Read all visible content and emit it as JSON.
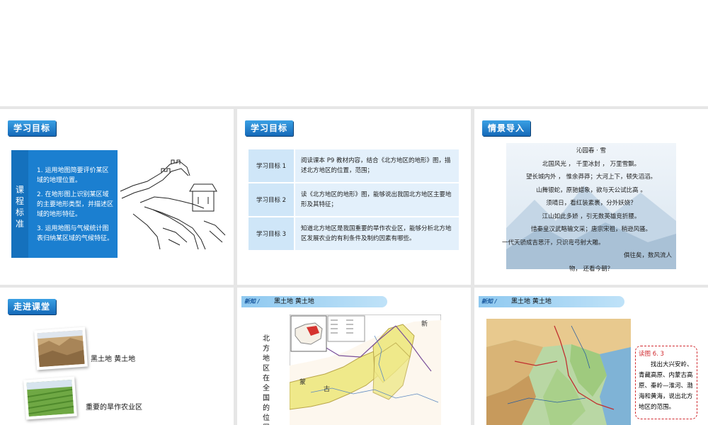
{
  "slides": [
    {
      "badge": "学习目标",
      "side_label": "课程标准",
      "goals": [
        "1. 运用地图简要评价某区域的地理位置。",
        "2. 在地形图上识别某区域的主要地形类型，并描述区域的地形特征。",
        "3. 运用地图与气候统计图表归纳某区域的气候特征。"
      ],
      "illustration": "great-wall-sketch"
    },
    {
      "badge": "学习目标",
      "rows": [
        {
          "label": "学习目标 1",
          "text": "阅读课本 P9 教材内容，结合《北方地区的地形》图，描 述北方地区的位置，范围；"
        },
        {
          "label": "学习目标 2",
          "text": "读《北方地区的地形》图，能够说出我国北方地区主要地形及其特征；"
        },
        {
          "label": "学习目标 3",
          "text": "知道北方地区是我国重要的旱作农业区，能够分析北方地区发展农业的有利条件及制约因素有哪些。"
        }
      ]
    },
    {
      "badge": "情景导入",
      "poem": [
        "沁园春 · 雪",
        "北国风光 ， 千里冰封 ， 万里雪飘。",
        "望长城内外 ， 惟余莽莽；大河上下，顿失滔滔。",
        "山舞银蛇，原驰蜡象，欲与天公试比高 。",
        "须晴日，看红装素裹，分外妖娆？",
        "江山如此多娇 ，引无数英雄竞折腰。",
        "惜秦皇汉武略输文采；唐宗宋祖，稍逊风骚。",
        "一代天骄成吉思汗，只识弯弓射大雕。",
        "俱往矣，数风流人",
        "物， 还看今朝？"
      ]
    },
    {
      "badge": "走进课堂",
      "items": [
        "黑土地  黄土地",
        "重要的旱作农业区"
      ]
    },
    {
      "tag": "新知 /",
      "topic": "黑土地  黄土地",
      "vertical_title": "北方地区在全国的位置",
      "map_labels": [
        "新",
        "蒙",
        "古"
      ]
    },
    {
      "tag": "新知 /",
      "topic": "黑土地  黄土地",
      "caption_title": "读图 6. 3",
      "caption_text": "找出大兴安岭、青藏高原、内蒙古高原、秦岭—淮河、渤海和黄海，说出北方地区的范围。"
    }
  ],
  "colors": {
    "accent_blue": "#1b7fd0",
    "badge_blue": "#1569b8",
    "caption_border": "#d0292e",
    "north_region_yellow": "#efe98a"
  }
}
